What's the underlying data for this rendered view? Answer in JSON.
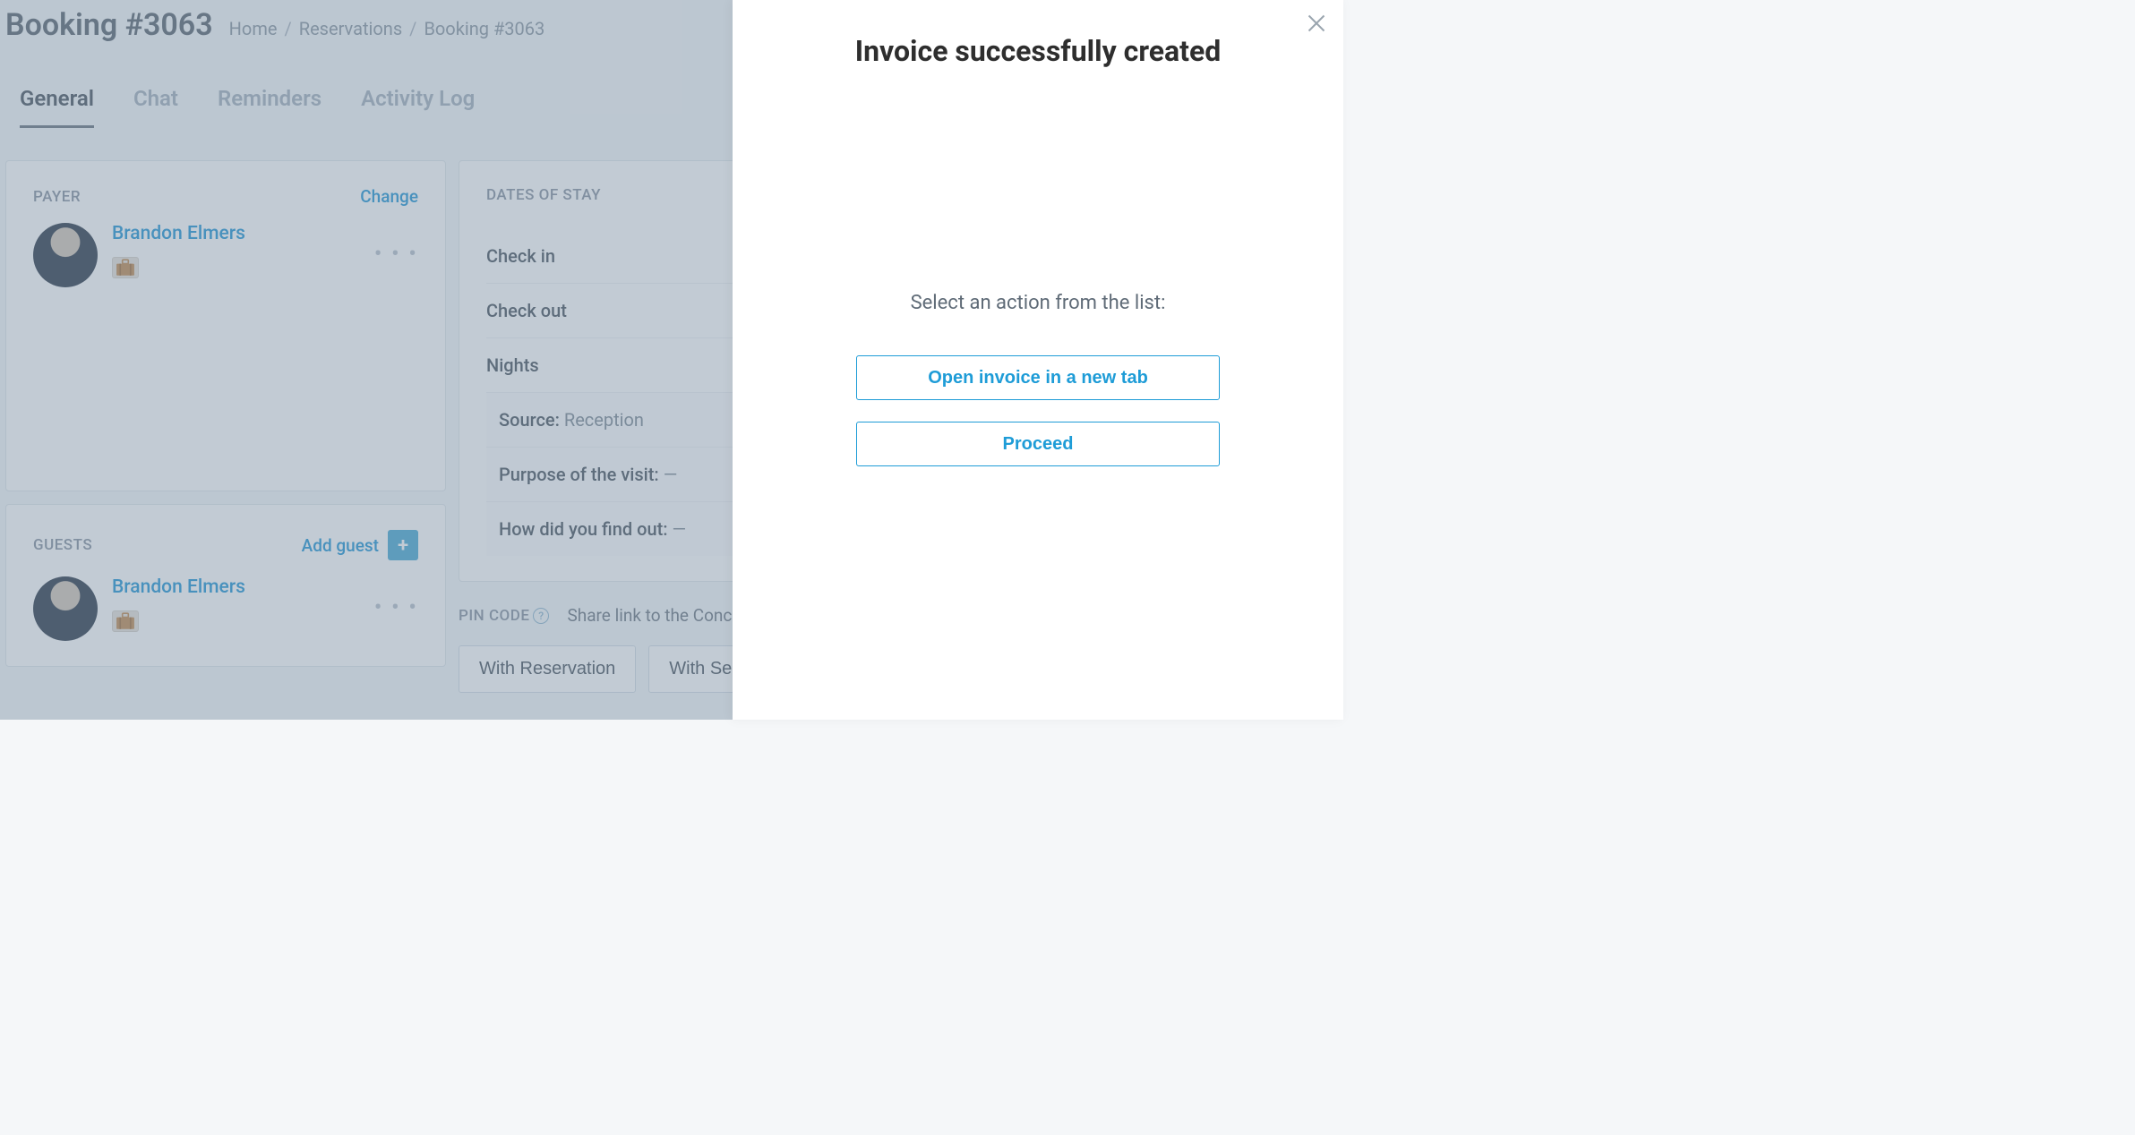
{
  "header": {
    "title": "Booking #3063",
    "breadcrumb": [
      "Home",
      "Reservations",
      "Booking #3063"
    ]
  },
  "tabs": [
    "General",
    "Chat",
    "Reminders",
    "Activity Log"
  ],
  "payer": {
    "section_label": "PAYER",
    "change_label": "Change",
    "name": "Brandon Elmers"
  },
  "guests": {
    "section_label": "GUESTS",
    "add_label": "Add guest",
    "list": [
      {
        "name": "Brandon Elmers"
      }
    ]
  },
  "stay": {
    "section_label": "DATES OF STAY",
    "checkin_label": "Check in",
    "checkout_label": "Check out",
    "nights_label": "Nights",
    "source_label": "Source:",
    "source_value": "Reception",
    "purpose_label": "Purpose of the visit:",
    "purpose_value": "—",
    "findout_label": "How did you find out:",
    "findout_value": "—"
  },
  "pin": {
    "label": "PIN CODE",
    "share_text": "Share link to the Concierge",
    "with_reservation": "With Reservation",
    "with_self_checkin": "With Self Check-in"
  },
  "drawer": {
    "title": "Invoice successfully created",
    "hint": "Select an action from the list:",
    "open_tab": "Open invoice in a new tab",
    "proceed": "Proceed"
  }
}
